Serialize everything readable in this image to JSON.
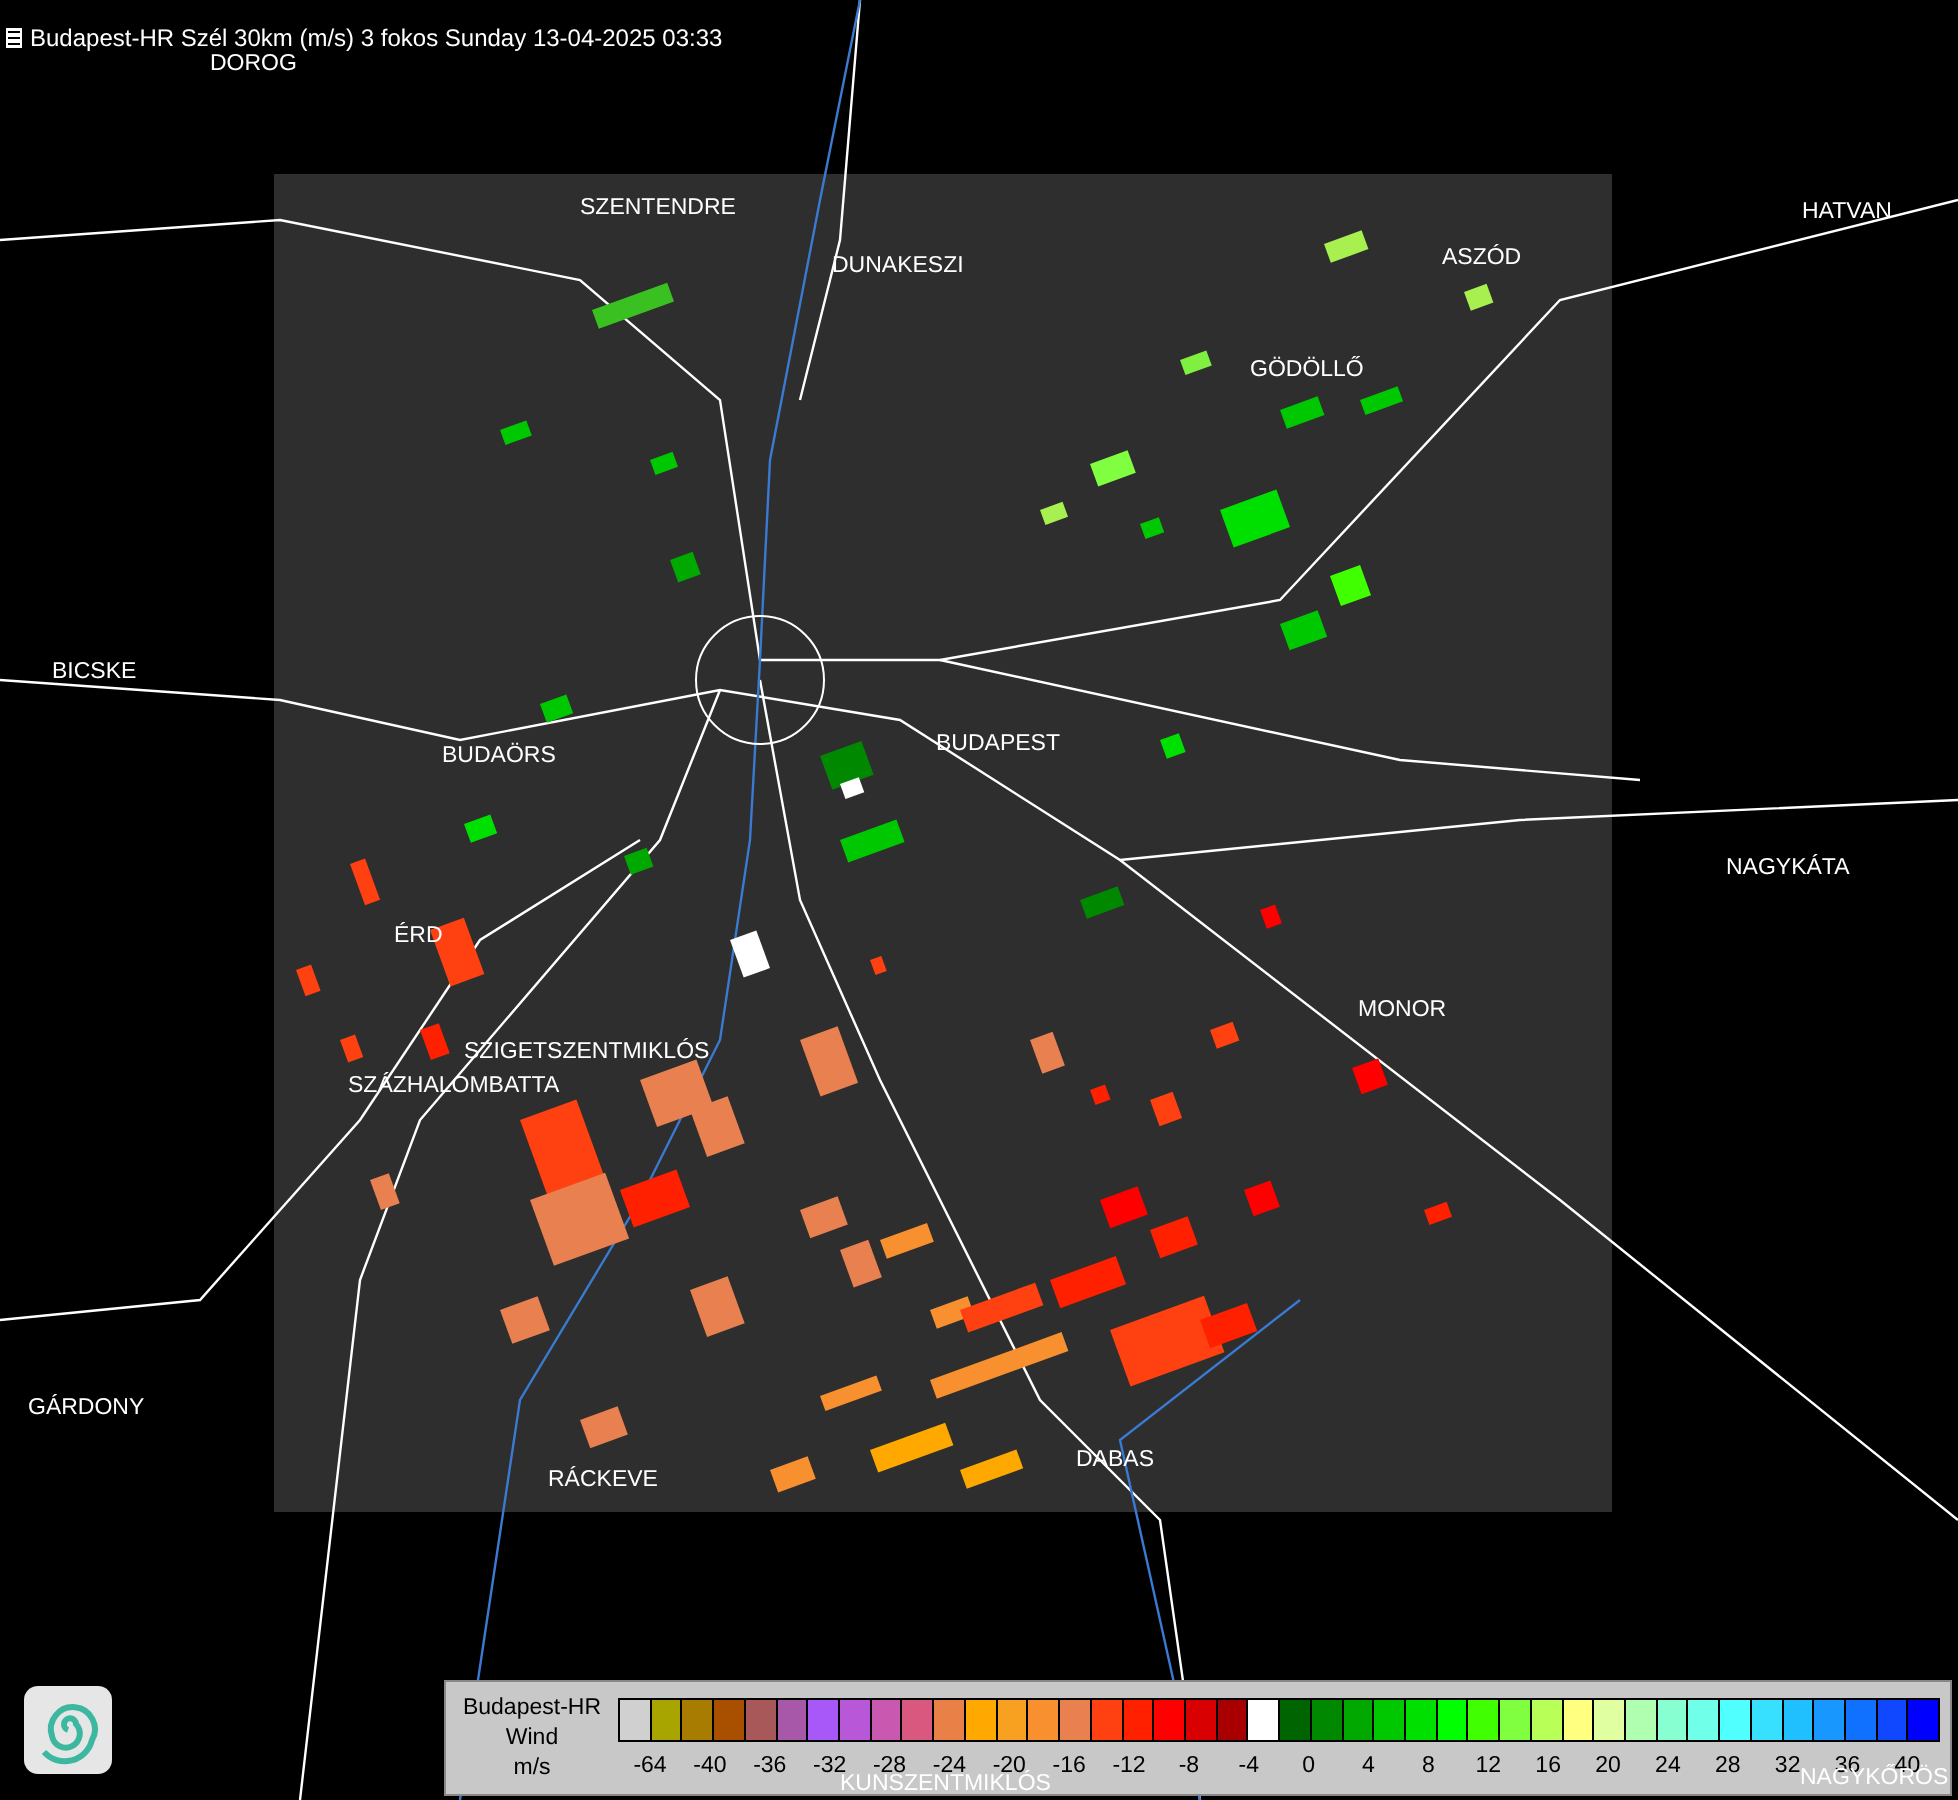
{
  "title": "Budapest-HR Szél 30km (m/s) 3 fokos Sunday 13-04-2025 03:33",
  "places": [
    "DOROG",
    "SZENTENDRE",
    "DUNAKESZI",
    "HATVAN",
    "ASZÓD",
    "GÖDÖLLŐ",
    "BICSKE",
    "BUDAÖRS",
    "BUDAPEST",
    "NAGYKÁTA",
    "ÉRD",
    "MONOR",
    "SZIGETSZENTMIKLÓS",
    "SZÁZHALOMBATTA",
    "GÁRDONY",
    "RÁCKEVE",
    "DABAS",
    "KUNSZENTMIKLÓS",
    "NAGYKŐRÖS"
  ],
  "legend": {
    "lines": [
      "Budapest-HR",
      "Wind",
      "m/s"
    ],
    "swatches": [
      {
        "color": "#d0d0d0"
      },
      {
        "color": "#a8a400"
      },
      {
        "color": "#a87c00"
      },
      {
        "color": "#a85000"
      },
      {
        "color": "#a85858"
      },
      {
        "color": "#a858a8"
      },
      {
        "color": "#a858f8"
      },
      {
        "color": "#b858d8"
      },
      {
        "color": "#c858b0"
      },
      {
        "color": "#d85880"
      },
      {
        "color": "#e88048"
      },
      {
        "color": "#ffa800"
      },
      {
        "color": "#f8a020"
      },
      {
        "color": "#f89030"
      },
      {
        "color": "#e88050"
      },
      {
        "color": "#ff4010"
      },
      {
        "color": "#ff2000"
      },
      {
        "color": "#ff0000"
      },
      {
        "color": "#d80000"
      },
      {
        "color": "#a80000"
      },
      {
        "color": "#ffffff"
      },
      {
        "color": "#006400"
      },
      {
        "color": "#008800"
      },
      {
        "color": "#00a800"
      },
      {
        "color": "#00c800"
      },
      {
        "color": "#00e000"
      },
      {
        "color": "#00ff00"
      },
      {
        "color": "#40ff00"
      },
      {
        "color": "#80ff40"
      },
      {
        "color": "#b8ff58"
      },
      {
        "color": "#ffff80"
      },
      {
        "color": "#e0ffa0"
      },
      {
        "color": "#b0ffb0"
      },
      {
        "color": "#88ffd0"
      },
      {
        "color": "#70ffe8"
      },
      {
        "color": "#50ffff"
      },
      {
        "color": "#38e0ff"
      },
      {
        "color": "#20c0ff"
      },
      {
        "color": "#1898ff"
      },
      {
        "color": "#1070ff"
      },
      {
        "color": "#1048ff"
      },
      {
        "color": "#0000ff"
      }
    ],
    "ticks": [
      "-64",
      "-40",
      "-36",
      "-32",
      "-28",
      "-24",
      "-20",
      "-16",
      "-12",
      "-8",
      "-4",
      "0",
      "4",
      "8",
      "12",
      "16",
      "20",
      "24",
      "28",
      "32",
      "36",
      "40"
    ]
  }
}
